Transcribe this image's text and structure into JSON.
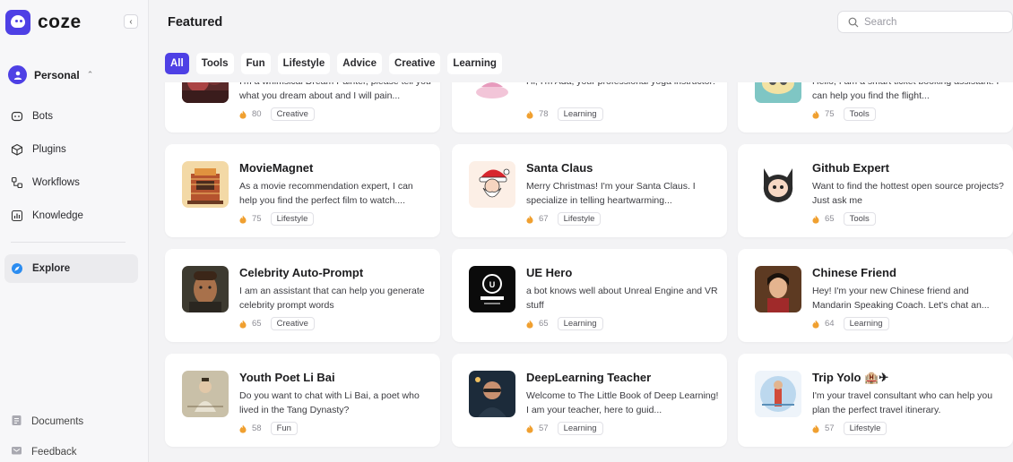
{
  "brand": {
    "name": "coze",
    "accent": "#4e40e5"
  },
  "workspace": {
    "label": "Personal"
  },
  "nav": [
    {
      "label": "Bots",
      "icon": "bot-icon"
    },
    {
      "label": "Plugins",
      "icon": "cube-icon"
    },
    {
      "label": "Workflows",
      "icon": "workflow-icon"
    },
    {
      "label": "Knowledge",
      "icon": "chart-icon"
    }
  ],
  "explore": {
    "label": "Explore",
    "icon": "compass-icon"
  },
  "bottom_nav": [
    {
      "label": "Documents",
      "icon": "document-icon"
    },
    {
      "label": "Feedback",
      "icon": "feedback-icon"
    }
  ],
  "header": {
    "title": "Featured"
  },
  "search": {
    "placeholder": "Search"
  },
  "tabs": [
    "All",
    "Tools",
    "Fun",
    "Lifestyle",
    "Advice",
    "Creative",
    "Learning"
  ],
  "active_tab": "All",
  "cards": [
    {
      "title": "",
      "desc": "I'm a whimsical Dream Painter, please tell you what you dream about and I will pain...",
      "count": "80",
      "tag": "Creative",
      "thumb": "dream-painter"
    },
    {
      "title": "",
      "desc": "Hi, I'm Ada, your professional yoga instructor!",
      "count": "78",
      "tag": "Learning",
      "thumb": "yoga"
    },
    {
      "title": "",
      "desc": "Hello, I am a smart ticket booking assistant. I can help you find the flight...",
      "count": "75",
      "tag": "Tools",
      "thumb": "ticket"
    },
    {
      "title": "MovieMagnet",
      "desc": "As a movie recommendation expert, I can help you find the perfect film to watch....",
      "count": "75",
      "tag": "Lifestyle",
      "thumb": "theater"
    },
    {
      "title": "Santa Claus",
      "desc": "Merry Christmas! I'm your Santa Claus. I specialize in telling heartwarming...",
      "count": "67",
      "tag": "Lifestyle",
      "thumb": "santa"
    },
    {
      "title": "Github Expert",
      "desc": "Want to find the hottest open source projects? Just ask me",
      "count": "65",
      "tag": "Tools",
      "thumb": "octocat"
    },
    {
      "title": "Celebrity Auto-Prompt",
      "desc": "I am an assistant that can help you generate celebrity prompt words",
      "count": "65",
      "tag": "Creative",
      "thumb": "portrait"
    },
    {
      "title": "UE Hero",
      "desc": "a bot knows well about Unreal Engine and VR stuff",
      "count": "65",
      "tag": "Learning",
      "thumb": "unreal"
    },
    {
      "title": "Chinese Friend",
      "desc": "Hey! I'm your new Chinese friend and Mandarin Speaking Coach. Let's chat an...",
      "count": "64",
      "tag": "Learning",
      "thumb": "chinese-girl"
    },
    {
      "title": "Youth Poet Li Bai",
      "desc": "Do you want to chat with Li Bai, a poet who lived in the Tang Dynasty?",
      "count": "58",
      "tag": "Fun",
      "thumb": "poet"
    },
    {
      "title": "DeepLearning Teacher",
      "desc": "Welcome to The Little Book of Deep Learning! I am your teacher, here to guid...",
      "count": "57",
      "tag": "Learning",
      "thumb": "teacher"
    },
    {
      "title": "Trip Yolo 🏨✈",
      "desc": "I'm your travel consultant who can help you plan the perfect travel itinerary.",
      "count": "57",
      "tag": "Lifestyle",
      "thumb": "travel"
    }
  ]
}
